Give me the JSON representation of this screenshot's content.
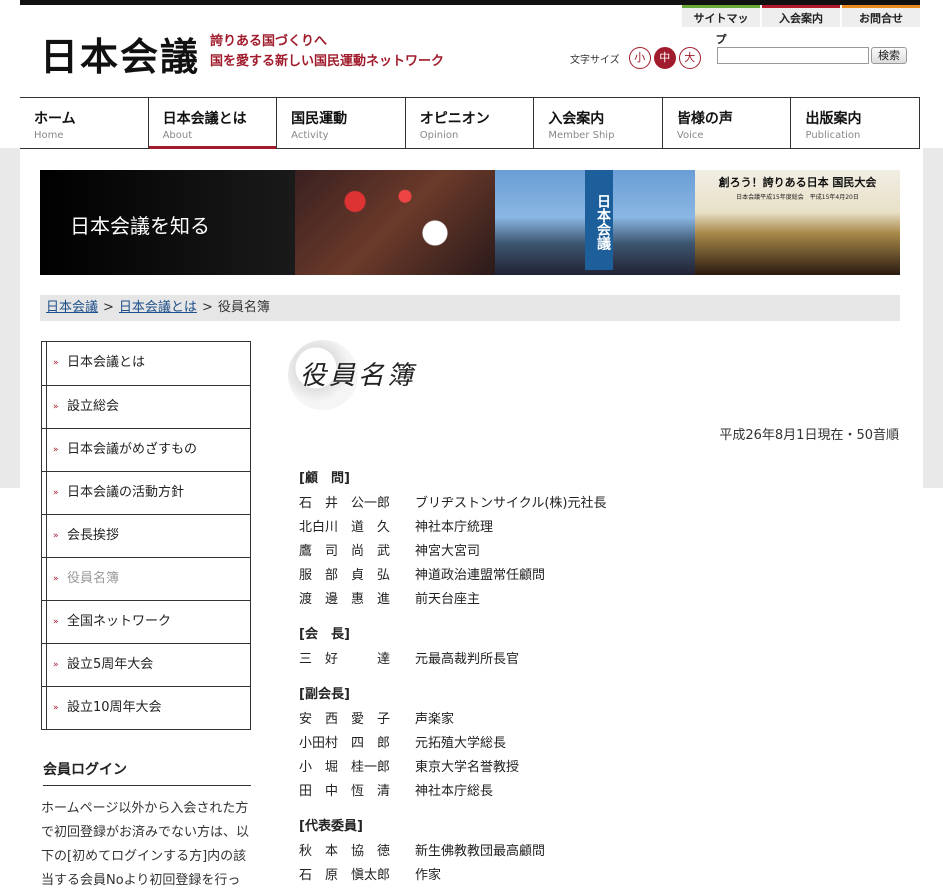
{
  "header": {
    "logo": "日本会議",
    "tagline_line1": "誇りある国づくりへ",
    "tagline_line2": "国を愛する新しい国民運動ネットワーク"
  },
  "util_nav": [
    {
      "label": "サイトマップ",
      "accent": "#6aa83a"
    },
    {
      "label": "入会案内",
      "accent": "#b5182a"
    },
    {
      "label": "お問合せ",
      "accent": "#e98a1e"
    }
  ],
  "font_size": {
    "label": "文字サイズ",
    "small": "小",
    "medium": "中",
    "large": "大",
    "selected": "中"
  },
  "search": {
    "value": "",
    "button_label": "検索"
  },
  "main_nav": [
    {
      "jp": "ホーム",
      "en": "Home"
    },
    {
      "jp": "日本会議とは",
      "en": "About"
    },
    {
      "jp": "国民運動",
      "en": "Activity"
    },
    {
      "jp": "オピニオン",
      "en": "Opinion"
    },
    {
      "jp": "入会案内",
      "en": "Member Ship"
    },
    {
      "jp": "皆様の声",
      "en": "Voice"
    },
    {
      "jp": "出版案内",
      "en": "Publication"
    }
  ],
  "hero": {
    "title": "日本会議を知る",
    "banner_text": "日本会議",
    "photo_caption": "創ろう！誇りある日本 国民大会",
    "photo_subcaption": "日本会議平成15年度総会　平成15年4月20日"
  },
  "breadcrumb": {
    "home": "日本会議",
    "section": "日本会議とは",
    "current": "役員名簿",
    "separator": ">"
  },
  "sidebar": {
    "items": [
      "日本会議とは",
      "設立総会",
      "日本会議がめざすもの",
      "日本会議の活動方針",
      "会長挨拶",
      "役員名簿",
      "全国ネットワーク",
      "設立5周年大会",
      "設立10周年大会"
    ],
    "current": "役員名簿",
    "login_title": "会員ログイン",
    "login_text": "ホームページ以外から入会された方で初回登録がお済みでない方は、以下の[初めてログインする方]内の該当する会員Noより初回登録を行っ"
  },
  "main": {
    "title": "役員名簿",
    "as_of": "平成26年8月1日現在・50音順",
    "groups": [
      {
        "title": "[顧　問]",
        "members": [
          {
            "name": "石　井　公一郎",
            "role": "ブリヂストンサイクル(株)元社長"
          },
          {
            "name": "北白川　道　久",
            "role": "神社本庁統理"
          },
          {
            "name": "鷹　司　尚　武",
            "role": "神宮大宮司"
          },
          {
            "name": "服　部　貞　弘",
            "role": "神道政治連盟常任顧問"
          },
          {
            "name": "渡　邊　惠　進",
            "role": "前天台座主"
          }
        ]
      },
      {
        "title": "[会　長]",
        "members": [
          {
            "name": "三　好　　　達",
            "role": "元最高裁判所長官"
          }
        ]
      },
      {
        "title": "[副会長]",
        "members": [
          {
            "name": "安　西　愛　子",
            "role": "声楽家"
          },
          {
            "name": "小田村　四　郎",
            "role": "元拓殖大学総長"
          },
          {
            "name": "小　堀　桂一郎",
            "role": "東京大学名誉教授"
          },
          {
            "name": "田　中　恆　清",
            "role": "神社本庁総長"
          }
        ]
      },
      {
        "title": "[代表委員]",
        "members": [
          {
            "name": "秋　本　協　徳",
            "role": "新生佛教教団最高顧問"
          },
          {
            "name": "石　原　愼太郎",
            "role": "作家"
          }
        ]
      }
    ]
  }
}
